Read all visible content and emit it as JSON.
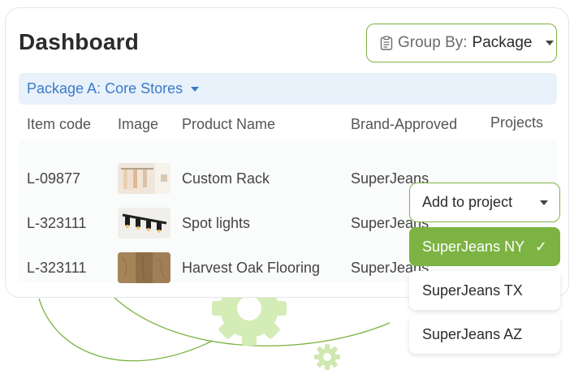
{
  "header": {
    "title": "Dashboard"
  },
  "group_by": {
    "label": "Group By:",
    "value": "Package",
    "icon": "clipboard-icon"
  },
  "package": {
    "label": "Package A: Core Stores"
  },
  "table": {
    "columns": [
      "Item code",
      "Image",
      "Product Name",
      "Brand-Approved",
      "Projects"
    ],
    "rows": [
      {
        "code": "L-09877",
        "image": "clothing-rack-thumbnail",
        "name": "Custom Rack",
        "brand": "SuperJeans"
      },
      {
        "code": "L-323111",
        "image": "spot-lights-thumbnail",
        "name": "Spot lights",
        "brand": "SuperJeans"
      },
      {
        "code": "L-323111",
        "image": "oak-flooring-thumbnail",
        "name": "Harvest Oak Flooring",
        "brand": "SuperJeans"
      }
    ]
  },
  "project_dropdown": {
    "label": "Add to project",
    "options": [
      {
        "label": "SuperJeans NY",
        "selected": true
      },
      {
        "label": "SuperJeans TX",
        "selected": false
      },
      {
        "label": "SuperJeans AZ",
        "selected": false
      }
    ]
  },
  "colors": {
    "accent": "#7cb342",
    "link": "#3a7bc8",
    "package_bg": "#e9f1fb"
  }
}
